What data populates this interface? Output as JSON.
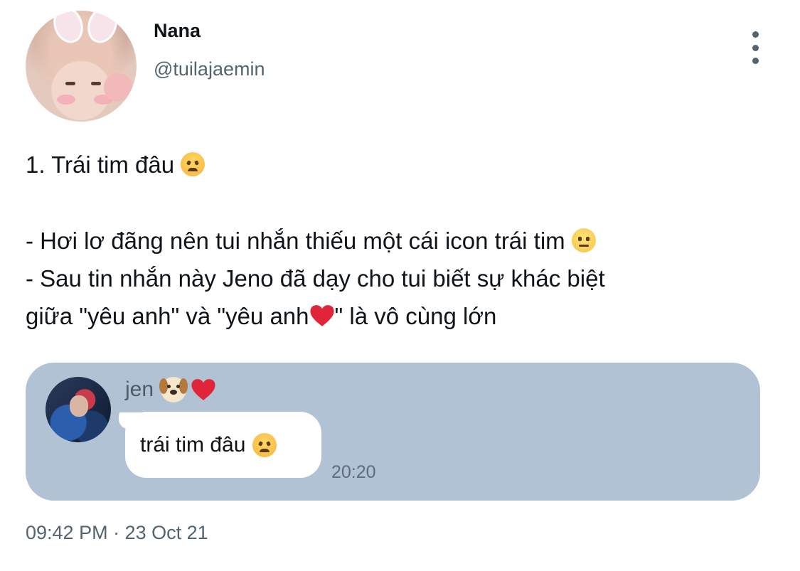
{
  "tweet": {
    "author_name": "Nana",
    "author_handle": "@tuilajaemin",
    "line1": "1. Trái tim đâu",
    "line2": "- Hơi lơ đãng nên tui nhắn thiếu một cái icon trái tim",
    "line3": "- Sau tin nhắn này Jeno đã dạy cho tui biết sự khác biệt",
    "line4_part1": "giữa \"yêu anh\" và \"yêu anh",
    "line4_part2": "\" là vô cùng lớn",
    "timestamp": "09:42 PM · 23 Oct 21"
  },
  "chat": {
    "sender_name": "jen",
    "message": "trái tim đâu",
    "message_time": "20:20",
    "background": "#b0c2d3"
  },
  "icons": {
    "more": "more-vertical-icon",
    "angry": "angry-face-emoji",
    "neutral": "neutral-face-emoji",
    "heart": "red-heart-emoji",
    "dog": "dog-face-emoji"
  },
  "colors": {
    "secondary_text": "#536471",
    "heart": "#e0243a"
  }
}
